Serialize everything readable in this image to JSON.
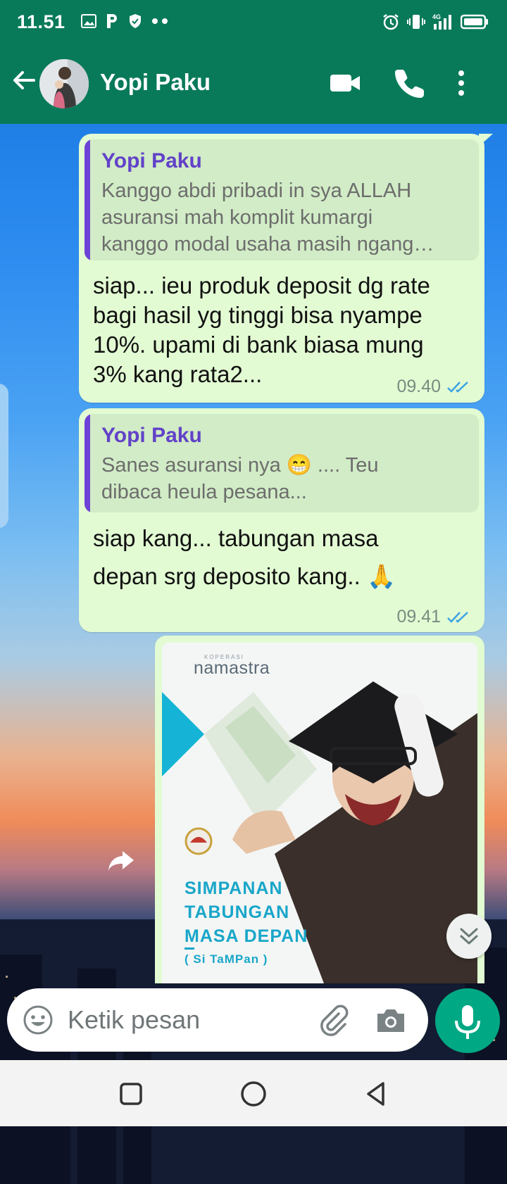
{
  "status_bar": {
    "time": "11.51",
    "left_icons": [
      "gallery-icon",
      "parking-icon",
      "shield-icon",
      "dots-icon"
    ],
    "right_icons": [
      "alarm-icon",
      "vibrate-icon",
      "signal-4g-icon",
      "battery-icon"
    ]
  },
  "header": {
    "contact_name": "Yopi Paku",
    "icons": [
      "back-arrow-icon",
      "video-call-icon",
      "voice-call-icon",
      "more-options-icon"
    ]
  },
  "messages": [
    {
      "direction": "outgoing",
      "quote": {
        "name": "Yopi Paku",
        "text": "Kanggo abdi pribadi in sya ALLAH\nasuransi mah komplit kumargi\nkanggo modal usaha masih ngang…"
      },
      "text": "siap... ieu produk deposit dg rate\nbagi hasil yg tinggi bisa nyampe\n10%. upami di bank biasa mung\n3% kang rata2...",
      "time": "09.40",
      "status": "read"
    },
    {
      "direction": "outgoing",
      "quote": {
        "name": "Yopi Paku",
        "text": "Sanes asuransi nya 😁 .... Teu\ndibaca heula pesana..."
      },
      "text": "siap kang... tabungan masa\ndepan srg deposito kang.. 🙏",
      "time": "09.41",
      "status": "read"
    },
    {
      "direction": "outgoing",
      "type": "image",
      "image": {
        "brand": "namastra",
        "brand_prefix": "KOPERASI",
        "title_lines": [
          "SIMPANAN",
          "TABUNGAN",
          "MASA DEPAN"
        ],
        "subtitle": "( Si TaMPan )"
      }
    }
  ],
  "composer": {
    "placeholder": "Ketik pesan",
    "icons": [
      "emoji-icon",
      "attach-icon",
      "camera-icon",
      "mic-icon"
    ]
  },
  "colors": {
    "header": "#087a5a",
    "bubble": "#e2fbd3",
    "quote_bar": "#6c43d6",
    "quote_name": "#6241c9",
    "read_ticks": "#3aa3e3",
    "mic_button": "#01a884"
  }
}
